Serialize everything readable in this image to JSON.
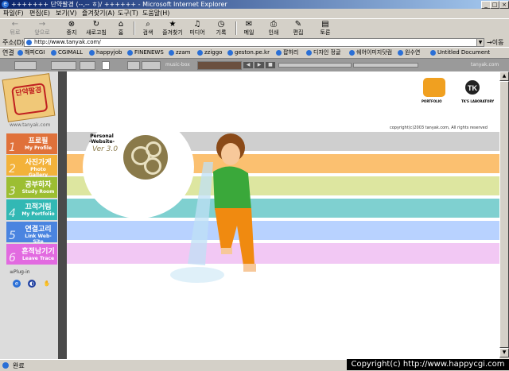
{
  "window": {
    "title": "+++++++ 단약팔경 (--,-- ㅎ)/ ++++++ - Microsoft Internet Explorer"
  },
  "menu": [
    "파일(F)",
    "편집(E)",
    "보기(V)",
    "즐겨찾기(A)",
    "도구(T)",
    "도움말(H)"
  ],
  "toolbar": [
    "뒤로",
    "앞으로",
    "중지",
    "새로고침",
    "홈",
    "검색",
    "즐겨찾기",
    "미디어",
    "기록",
    "메일",
    "인쇄",
    "편집",
    "토론"
  ],
  "address": {
    "label": "주소(D)",
    "url": "http://www.tanyak.com/",
    "go": "이동"
  },
  "links": {
    "label": "연결",
    "items": [
      "해피CGI",
      "CGIMALL",
      "happyjob",
      "FINENEWS",
      "zzam",
      "zziggo",
      "geston.pe.kr",
      "팝허리",
      "디자인 정글",
      "쉐어이미지닷컴",
      "원수연",
      "Untitled Document"
    ]
  },
  "player": {
    "music_label": "music-box",
    "domain": "tanyak.com"
  },
  "site": {
    "logo_text": "단약팔경",
    "logo_url": "www.tanyak.com",
    "personal_title": "Personal\n-Website-",
    "version": "Ver 3.0",
    "copyright": "copyright(c)2003 tanyak.com, All rights reserved",
    "portfolio_label": "PORTFOLIO",
    "lab_label": "TK'S LABORATORY",
    "plugin_label": "Plug-in"
  },
  "nav": [
    {
      "num": "1",
      "ko": "프로필",
      "en": "My Profile",
      "color": "#e0713a"
    },
    {
      "num": "2",
      "ko": "사진가게",
      "en": "Photo Gallery",
      "color": "#f3b23a"
    },
    {
      "num": "3",
      "ko": "공부하자",
      "en": "Study Room",
      "color": "#9cbe32"
    },
    {
      "num": "4",
      "ko": "끄적거림",
      "en": "My Portfolio",
      "color": "#32b8b4"
    },
    {
      "num": "5",
      "ko": "연결고리",
      "en": "Link Web-Site",
      "color": "#4a84e0"
    },
    {
      "num": "6",
      "ko": "흔적남기기",
      "en": "Leave Trace",
      "color": "#e26ae0"
    }
  ],
  "bands": [
    {
      "color": "#cfcfcf"
    },
    {
      "color": "#fbc070"
    },
    {
      "color": "#dde6a0"
    },
    {
      "color": "#7fd0d0"
    },
    {
      "color": "#b8d2ff"
    },
    {
      "color": "#f2c8f4"
    }
  ],
  "status": {
    "text": "완료"
  },
  "watermark": "Copyright(c) http://www.happycgi.com"
}
